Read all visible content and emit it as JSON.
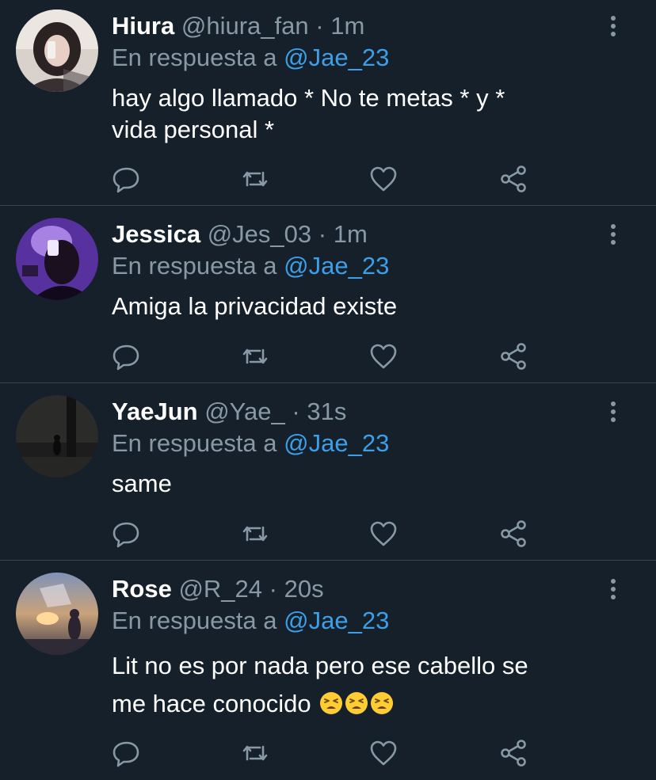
{
  "tweets": [
    {
      "name": "Hiura",
      "handle": "@hiura_fan",
      "dot": "·",
      "time": "1m",
      "reply_prefix": "En respuesta a",
      "reply_to": "@Jae_23",
      "text_line1": "hay algo llamado * No te metas * y *",
      "text_line2": "vida personal *"
    },
    {
      "name": "Jessica",
      "handle": "@Jes_03",
      "dot": "·",
      "time": "1m",
      "reply_prefix": "En respuesta a",
      "reply_to": "@Jae_23",
      "text_line1": "Amiga la privacidad existe"
    },
    {
      "name": "YaeJun",
      "handle": "@Yae_",
      "dot": "·",
      "time": "31s",
      "reply_prefix": "En respuesta a",
      "reply_to": "@Jae_23",
      "text_line1": "same"
    },
    {
      "name": "Rose",
      "handle": "@R_24",
      "dot": "·",
      "time": "20s",
      "reply_prefix": "En respuesta a",
      "reply_to": "@Jae_23",
      "text_line1": "Lit no es por nada pero ese cabello se",
      "text_line2": "me hace conocido",
      "emoji_names": [
        "tired-face-emoji",
        "tired-face-emoji",
        "tired-face-emoji"
      ]
    }
  ],
  "icons": {
    "reply": "reply-icon",
    "retweet": "retweet-icon",
    "like": "heart-icon",
    "share": "share-icon",
    "more": "more-vertical-icon"
  },
  "colors": {
    "background": "#15202b",
    "divider": "#38444d",
    "secondary_text": "#8899a6",
    "mention": "#3d9fe8"
  }
}
